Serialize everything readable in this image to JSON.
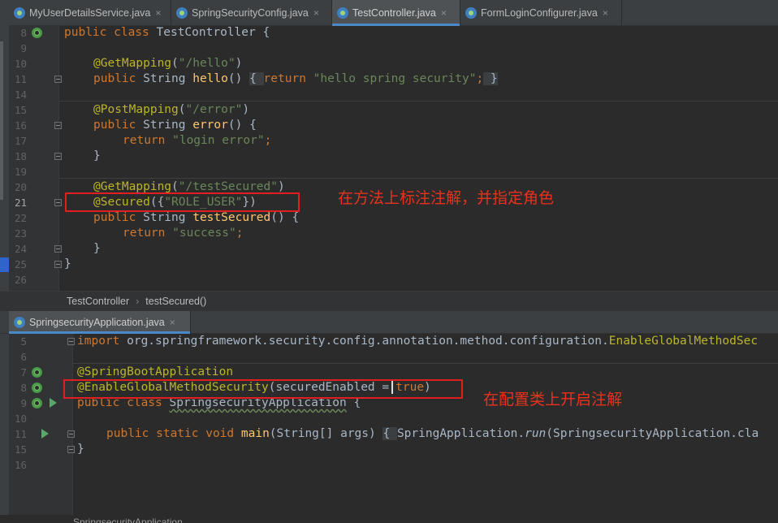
{
  "top_tabs": [
    {
      "label": "MyUserDetailsService.java",
      "active": false
    },
    {
      "label": "SpringSecurityConfig.java",
      "active": false
    },
    {
      "label": "TestController.java",
      "active": true
    },
    {
      "label": "FormLoginConfigurer.java",
      "active": false
    }
  ],
  "bottom_tabs": [
    {
      "label": "SpringsecurityApplication.java",
      "active": true
    }
  ],
  "close_glyph": "×",
  "editor1": {
    "lines": [
      "8",
      "9",
      "10",
      "11",
      "14",
      "15",
      "16",
      "17",
      "18",
      "19",
      "20",
      "21",
      "22",
      "23",
      "24",
      "25",
      "26"
    ],
    "code": {
      "l8_kw": "public class ",
      "l8_name": "TestController {",
      "l10_ann": "@GetMapping",
      "l10_open": "(",
      "l10_str": "\"/hello\"",
      "l10_close": ")",
      "l11_kw": "public ",
      "l11_type": "String ",
      "l11_fn": "hello",
      "l11_paren": "() ",
      "l11_fold_open": "{ ",
      "l11_ret": "return ",
      "l11_str": "\"hello spring security\"",
      "l11_semi": ";",
      "l11_fold_close": " }",
      "l15_ann": "@PostMapping",
      "l15_open": "(",
      "l15_str": "\"/error\"",
      "l15_close": ")",
      "l16_kw": "public ",
      "l16_type": "String ",
      "l16_fn": "error",
      "l16_rest": "() {",
      "l17_ret": "return ",
      "l17_str": "\"login error\"",
      "l17_semi": ";",
      "l18": "}",
      "l20_ann": "@GetMapping",
      "l20_open": "(",
      "l20_str": "\"/testSecured\"",
      "l20_close": ")",
      "l21_ann": "@Secured",
      "l21_open": "({",
      "l21_str": "\"ROLE_USER\"",
      "l21_close": "})",
      "l22_kw": "public ",
      "l22_type": "String ",
      "l22_fn": "testSecured",
      "l22_rest": "() {",
      "l23_ret": "return ",
      "l23_str": "\"success\"",
      "l23_semi": ";",
      "l24": "}",
      "l25": "}"
    },
    "annotation_note": "在方法上标注注解，并指定角色"
  },
  "breadcrumb": {
    "class": "TestController",
    "separator": "›",
    "method": "testSecured()"
  },
  "editor2": {
    "lines": [
      "5",
      "6",
      "7",
      "8",
      "9",
      "10",
      "11",
      "15",
      "16"
    ],
    "code": {
      "l5_kw": "import ",
      "l5_pkg": "org.springframework.security.config.annotation.method.configuration.",
      "l5_cls": "EnableGlobalMethodSec",
      "l7_ann": "@SpringBootApplication",
      "l8_ann": "@EnableGlobalMethodSecurity",
      "l8_open": "(",
      "l8_param": "securedEnabled =",
      "l8_val": "true",
      "l8_close": ")",
      "l9_kw": "public class ",
      "l9_name": "SpringsecurityApplication",
      "l9_rest": " {",
      "l11_kw": "public static void ",
      "l11_fn": "main",
      "l11_args": "(String[] args) ",
      "l11_fold": "{ ",
      "l11_call1": "SpringApplication.",
      "l11_run": "run",
      "l11_call2": "(SpringsecurityApplication.cla",
      "l15": "}"
    },
    "annotation_note": "在配置类上开启注解"
  },
  "bottom_status": "SpringsecurityApplication"
}
